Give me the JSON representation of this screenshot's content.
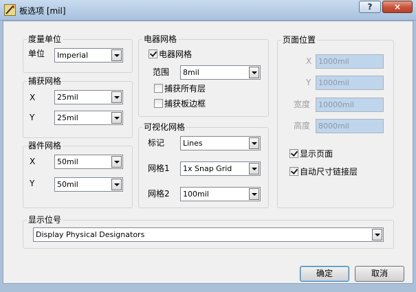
{
  "window": {
    "title": "板选项 [mil]",
    "help_label": "?",
    "close_label": "×"
  },
  "measurement_unit": {
    "group_title": "度量单位",
    "unit_label": "单位",
    "unit_value": "Imperial"
  },
  "snap_grid": {
    "group_title": "捕获网格",
    "x_label": "X",
    "x_value": "25mil",
    "y_label": "Y",
    "y_value": "25mil"
  },
  "component_grid": {
    "group_title": "器件网格",
    "x_label": "X",
    "x_value": "50mil",
    "y_label": "Y",
    "y_value": "50mil"
  },
  "electrical_grid": {
    "group_title": "电器网格",
    "enabled_label": "电器网格",
    "enabled": true,
    "range_label": "范围",
    "range_value": "8mil",
    "snap_all_layers_label": "捕获所有层",
    "snap_all_layers": false,
    "snap_board_outline_label": "捕获板边框",
    "snap_board_outline": false
  },
  "visible_grid": {
    "group_title": "可视化网格",
    "marker_label": "标记",
    "marker_value": "Lines",
    "grid1_label": "网格1",
    "grid1_value": "1x Snap Grid",
    "grid2_label": "网格2",
    "grid2_value": "100mil"
  },
  "page_position": {
    "group_title": "页面位置",
    "x_label": "X",
    "x_value": "1000mil",
    "y_label": "Y",
    "y_value": "1000mil",
    "width_label": "宽度",
    "width_value": "10000mil",
    "height_label": "高度",
    "height_value": "8000mil",
    "show_page_label": "显示页面",
    "show_page": true,
    "auto_size_label": "自动尺寸链接层",
    "auto_size": true
  },
  "designator_display": {
    "group_title": "显示位号",
    "value": "Display Physical Designators"
  },
  "buttons": {
    "ok": "确定",
    "cancel": "取消"
  }
}
